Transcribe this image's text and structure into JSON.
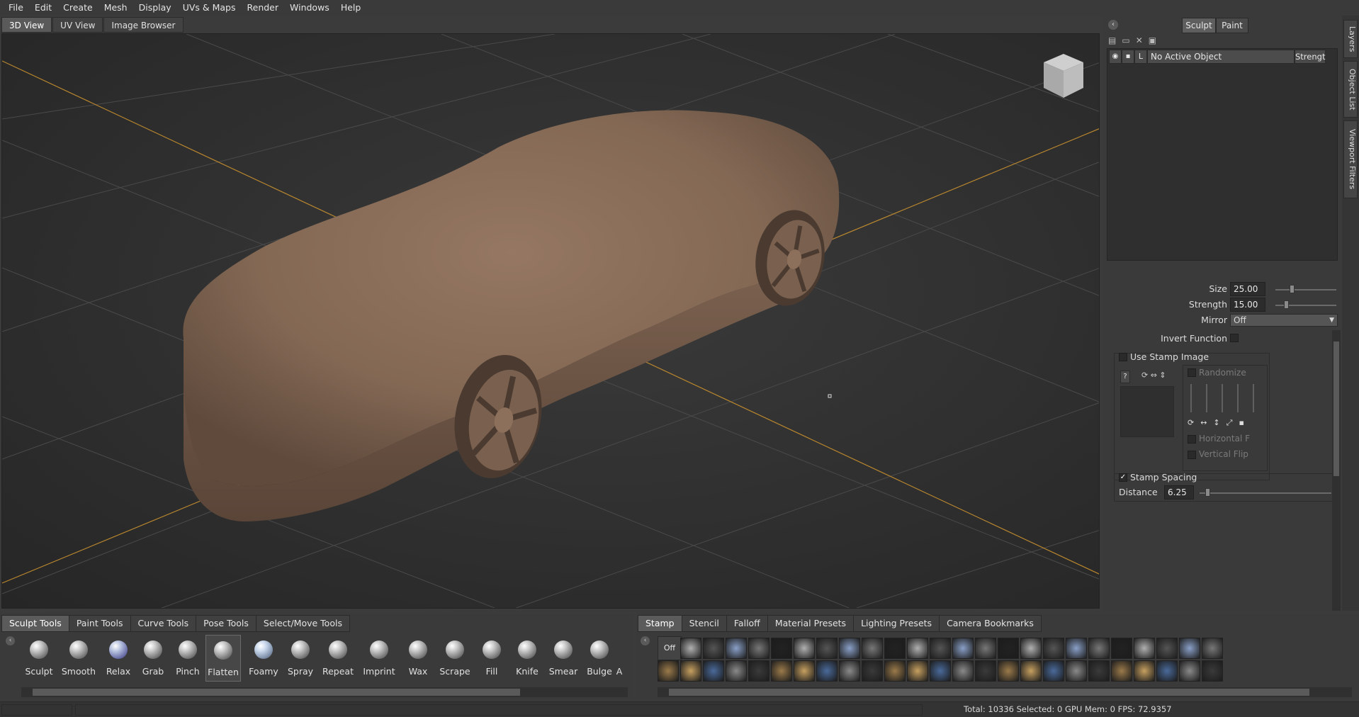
{
  "menu": [
    "File",
    "Edit",
    "Create",
    "Mesh",
    "Display",
    "UVs & Maps",
    "Render",
    "Windows",
    "Help"
  ],
  "view_tabs": [
    "3D View",
    "UV View",
    "Image Browser"
  ],
  "mode_tabs": [
    "Sculpt",
    "Paint"
  ],
  "side_tabs": [
    "Layers",
    "Object List",
    "Viewport Filters"
  ],
  "layers": {
    "row_label": "L",
    "object_name": "No Active Object",
    "strength_header": "Strengt"
  },
  "brush": {
    "size_label": "Size",
    "size_value": "25.00",
    "strength_label": "Strength",
    "strength_value": "15.00",
    "mirror_label": "Mirror",
    "mirror_value": "Off",
    "invert_label": "Invert Function",
    "use_stamp_label": "Use Stamp Image",
    "stamp_q": "?",
    "randomize_label": "Randomize",
    "horizontal_label": "Horizontal F",
    "vertical_label": "Vertical Flip",
    "spacing_label": "Stamp Spacing",
    "distance_label": "Distance",
    "distance_value": "6.25"
  },
  "tool_tabs": [
    "Sculpt Tools",
    "Paint Tools",
    "Curve Tools",
    "Pose Tools",
    "Select/Move Tools"
  ],
  "tools": [
    "Sculpt",
    "Smooth",
    "Relax",
    "Grab",
    "Pinch",
    "Flatten",
    "Foamy",
    "Spray",
    "Repeat",
    "Imprint",
    "Wax",
    "Scrape",
    "Fill",
    "Knife",
    "Smear",
    "Bulge",
    "A"
  ],
  "active_tool": "Flatten",
  "stamp_tabs": [
    "Stamp",
    "Stencil",
    "Falloff",
    "Material Presets",
    "Lighting Presets",
    "Camera Bookmarks"
  ],
  "stamp_off_label": "Off",
  "status": "Total: 10336  Selected: 0 GPU Mem: 0  FPS: 72.9357",
  "colors": {
    "clay": "#8a6e5c",
    "grid_axis": "#b8862e",
    "accent": "#5a5a5a"
  }
}
